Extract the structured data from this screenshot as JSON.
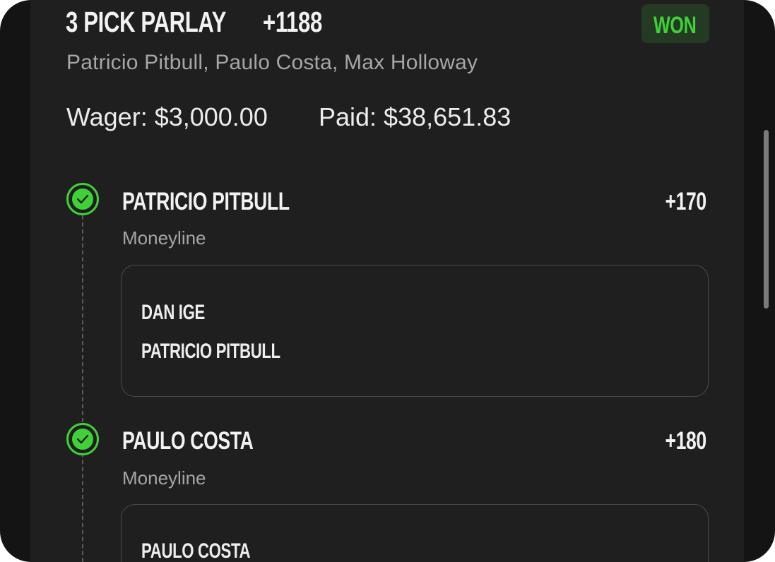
{
  "bet": {
    "title": "3 PICK PARLAY",
    "odds": "+1188",
    "status": "WON",
    "subtitle": "Patricio Pitbull, Paulo Costa, Max Holloway",
    "wager_text": "Wager: $3,000.00",
    "paid_text": "Paid: $38,651.83"
  },
  "legs": [
    {
      "name": "PATRICIO PITBULL",
      "odds": "+170",
      "type": "Moneyline",
      "status_icon": "check-circle-icon",
      "matchup": [
        "DAN IGE",
        "PATRICIO PITBULL"
      ]
    },
    {
      "name": "PAULO COSTA",
      "odds": "+180",
      "type": "Moneyline",
      "status_icon": "check-circle-icon",
      "matchup": [
        "PAULO COSTA"
      ]
    }
  ],
  "colors": {
    "accent_green": "#3fd137",
    "won_badge_bg": "#243a23",
    "panel_bg": "#1f1f1f"
  }
}
